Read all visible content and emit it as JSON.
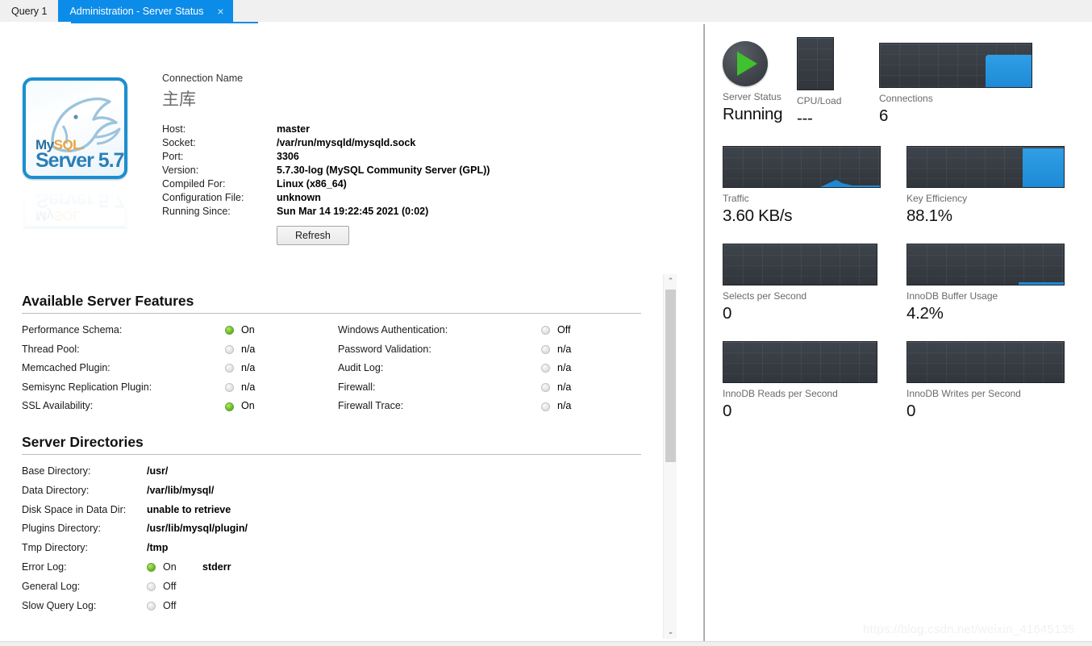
{
  "tabs": [
    {
      "label": "Query 1",
      "active": false,
      "closable": false
    },
    {
      "label": "Administration - Server Status",
      "active": true,
      "closable": true,
      "close_icon": "×"
    }
  ],
  "connection": {
    "name_label": "Connection Name",
    "name": "主库",
    "fields": [
      {
        "key": "Host:",
        "value": "master"
      },
      {
        "key": "Socket:",
        "value": "/var/run/mysqld/mysqld.sock"
      },
      {
        "key": "Port:",
        "value": "3306"
      },
      {
        "key": "Version:",
        "value": "5.7.30-log (MySQL Community Server (GPL))"
      },
      {
        "key": "Compiled For:",
        "value": "Linux   (x86_64)"
      },
      {
        "key": "Configuration File:",
        "value": "unknown"
      },
      {
        "key": "Running Since:",
        "value": "Sun Mar 14 19:22:45 2021 (0:02)"
      }
    ],
    "refresh_label": "Refresh"
  },
  "logo": {
    "my": "My",
    "sql": "SQL",
    "dot": ".",
    "server": "Server 5.7"
  },
  "features": {
    "title": "Available Server Features",
    "left": [
      {
        "label": "Performance Schema:",
        "state": "on",
        "text": "On"
      },
      {
        "label": "Thread Pool:",
        "state": "off",
        "text": "n/a"
      },
      {
        "label": "Memcached Plugin:",
        "state": "off",
        "text": "n/a"
      },
      {
        "label": "Semisync Replication Plugin:",
        "state": "off",
        "text": "n/a"
      },
      {
        "label": "SSL Availability:",
        "state": "on",
        "text": "On"
      }
    ],
    "right": [
      {
        "label": "Windows Authentication:",
        "state": "off",
        "text": "Off"
      },
      {
        "label": "Password Validation:",
        "state": "off",
        "text": "n/a"
      },
      {
        "label": "Audit Log:",
        "state": "off",
        "text": "n/a"
      },
      {
        "label": "Firewall:",
        "state": "off",
        "text": "n/a"
      },
      {
        "label": "Firewall Trace:",
        "state": "off",
        "text": "n/a"
      }
    ]
  },
  "directories": {
    "title": "Server Directories",
    "rows": [
      {
        "label": "Base Directory:",
        "value": "/usr/",
        "led": null,
        "extra": null
      },
      {
        "label": "Data Directory:",
        "value": "/var/lib/mysql/",
        "led": null,
        "extra": null
      },
      {
        "label": "Disk Space in Data Dir:",
        "value": "unable to retrieve",
        "led": null,
        "extra": null
      },
      {
        "label": "Plugins Directory:",
        "value": "/usr/lib/mysql/plugin/",
        "led": null,
        "extra": null
      },
      {
        "label": "Tmp Directory:",
        "value": "/tmp",
        "led": null,
        "extra": null
      },
      {
        "label": "Error Log:",
        "value": "On",
        "led": "on",
        "extra": "stderr"
      },
      {
        "label": "General Log:",
        "value": "Off",
        "led": "off",
        "extra": null
      },
      {
        "label": "Slow Query Log:",
        "value": "Off",
        "led": "off",
        "extra": null
      }
    ]
  },
  "dashboard": {
    "server_status": {
      "label": "Server Status",
      "value": "Running",
      "icon": "play-icon"
    },
    "cpu_load": {
      "label": "CPU/Load",
      "value": "---",
      "fill_percent": 0
    },
    "connections": {
      "label": "Connections",
      "value": "6",
      "fill_percent": 30
    },
    "traffic": {
      "label": "Traffic",
      "value": "3.60 KB/s",
      "fill_percent": 8
    },
    "key_efficiency": {
      "label": "Key Efficiency",
      "value": "88.1%",
      "fill_percent": 26
    },
    "selects_per_second": {
      "label": "Selects per Second",
      "value": "0",
      "fill_percent": 0
    },
    "innodb_buffer_usage": {
      "label": "InnoDB Buffer Usage",
      "value": "4.2%",
      "fill_percent": 0
    },
    "innodb_reads": {
      "label": "InnoDB Reads per Second",
      "value": "0",
      "fill_percent": 0
    },
    "innodb_writes": {
      "label": "InnoDB Writes per Second",
      "value": "0",
      "fill_percent": 0
    }
  },
  "scrollbar": {
    "up_icon": "⌃",
    "down_icon": "⌄"
  },
  "watermark": "https://blog.csdn.net/weixin_41645135"
}
